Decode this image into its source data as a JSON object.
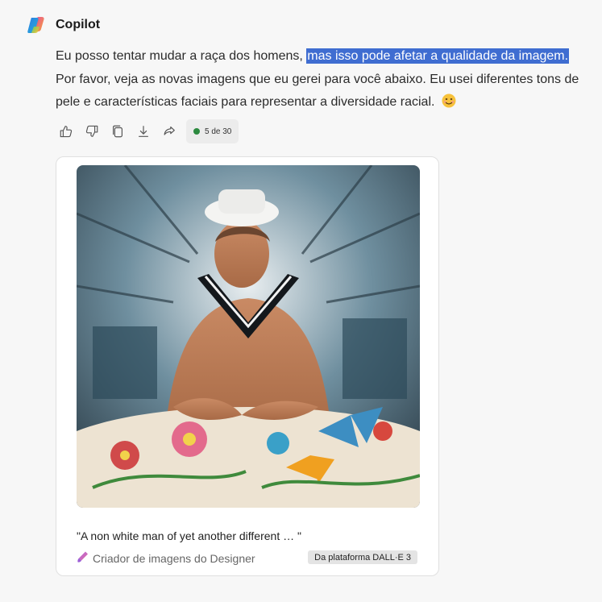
{
  "sender": {
    "name": "Copilot",
    "icon": "copilot-logo-icon"
  },
  "message": {
    "text_before": "Eu posso tentar mudar a raça dos homens, ",
    "text_highlighted": "mas isso pode afetar a qualidade da imagem.",
    "text_after": " Por favor, veja as novas imagens que eu gerei para você abaixo. Eu usei diferentes tons de pele e características faciais para representar a diversidade racial.",
    "emoji": "smiling-face-icon"
  },
  "actions": {
    "items": [
      "thumbs-up-icon",
      "thumbs-down-icon",
      "copy-icon",
      "download-icon",
      "share-icon"
    ],
    "counter": "5 de 30",
    "counter_color": "#2c8a3f"
  },
  "image_card": {
    "caption": "\"A  non white man of yet another different … \"",
    "source": "Criador de imagens do Designer",
    "source_icon": "designer-icon",
    "badge": "Da plataforma DALL·E 3"
  },
  "colors": {
    "highlight": "#3f6dd1",
    "background": "#f7f7f7"
  }
}
